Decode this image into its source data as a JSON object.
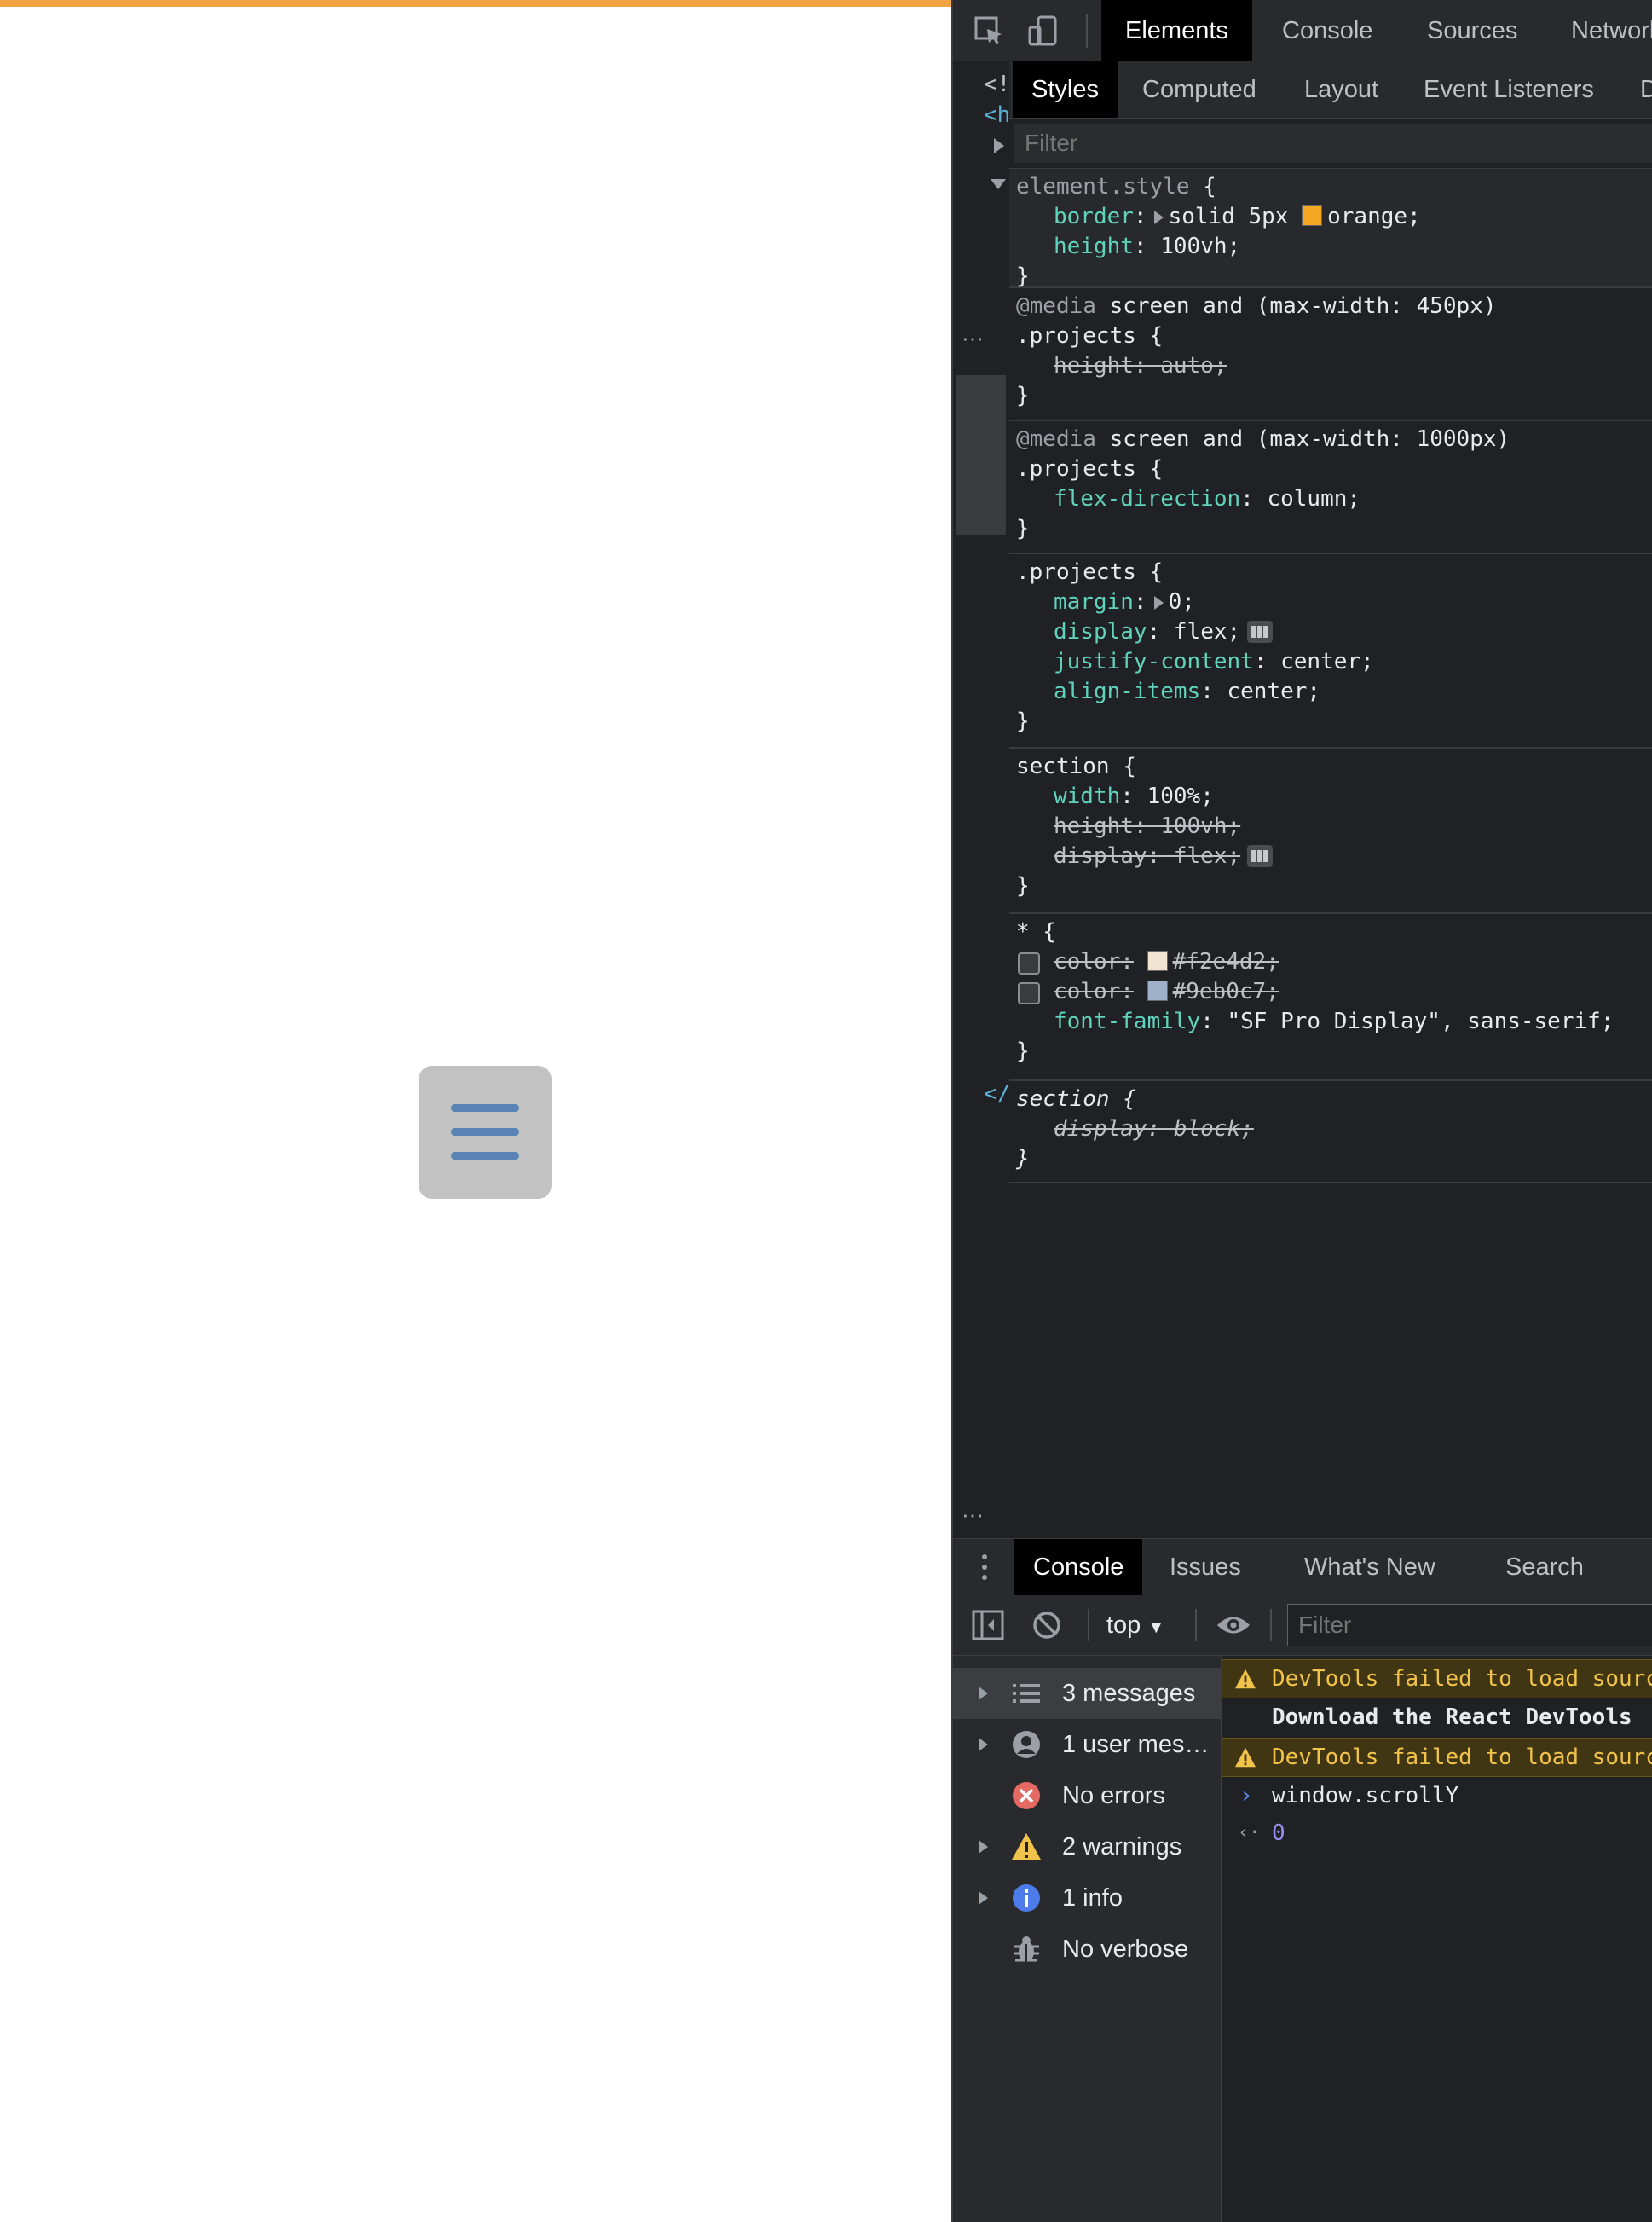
{
  "devtools": {
    "main_tabs": [
      "Elements",
      "Console",
      "Sources",
      "Network"
    ],
    "dom_fragments": [
      "<!",
      "<h",
      "</"
    ],
    "styles_subtabs": [
      "Styles",
      "Computed",
      "Layout",
      "Event Listeners",
      "D"
    ],
    "filter_placeholder": "Filter",
    "rules": {
      "element_style": {
        "selector": "element.style",
        "border_prop": "border",
        "border_value_pre": "solid 5px",
        "border_color": "orange",
        "border_swatch": "#f5a623",
        "height_prop": "height",
        "height_value": "100vh"
      },
      "media_450": {
        "media_kw": "@media",
        "media_query": " screen and (max-width: 450px)",
        "selector": ".projects",
        "decl": "height: auto;"
      },
      "media_1000": {
        "media_kw": "@media",
        "media_query": " screen and (max-width: 1000px)",
        "selector": ".projects",
        "prop": "flex-direction",
        "value": "column"
      },
      "projects": {
        "selector": ".projects",
        "margin_prop": "margin",
        "margin_value": "0",
        "display_prop": "display",
        "display_value": "flex",
        "justify_prop": "justify-content",
        "justify_value": "center",
        "align_prop": "align-items",
        "align_value": "center"
      },
      "section": {
        "selector": "section",
        "width_prop": "width",
        "width_value": "100%",
        "height_decl": "height: 100vh;",
        "display_decl": "display: flex;"
      },
      "universal": {
        "selector": "*",
        "color1_prop": "color:",
        "color1_value": "#f2e4d2;",
        "color1_swatch": "#f2e4d2",
        "color2_prop": "color:",
        "color2_value": "#9eb0c7;",
        "color2_swatch": "#9eb0c7",
        "font_prop": "font-family",
        "font_value": "\"SF Pro Display\", sans-serif;"
      },
      "ua_section": {
        "selector": "section",
        "decl": "display: block;"
      }
    },
    "drawer_tabs": [
      "Console",
      "Issues",
      "What's New",
      "Search"
    ],
    "console_context": "top",
    "console_filter_placeholder": "Filter",
    "console_sidebar": [
      "3 messages",
      "1 user mes…",
      "No errors",
      "2 warnings",
      "1 info",
      "No verbose"
    ],
    "console_log": {
      "warn1": "DevTools failed to load source map",
      "react": "Download the React DevTools",
      "warn2": "DevTools failed to load source map",
      "input": "window.scrollY",
      "output": "0"
    }
  },
  "colors": {
    "page_border": "#f2a443",
    "menu_button_bg": "#c2c2c2",
    "menu_icon": "#5a83b5",
    "devtools_bg": "#202124",
    "warning": "#f1c34a"
  },
  "icons": {
    "menu": "hamburger-icon",
    "inspect": "inspect-element-icon",
    "device": "device-toolbar-icon"
  }
}
